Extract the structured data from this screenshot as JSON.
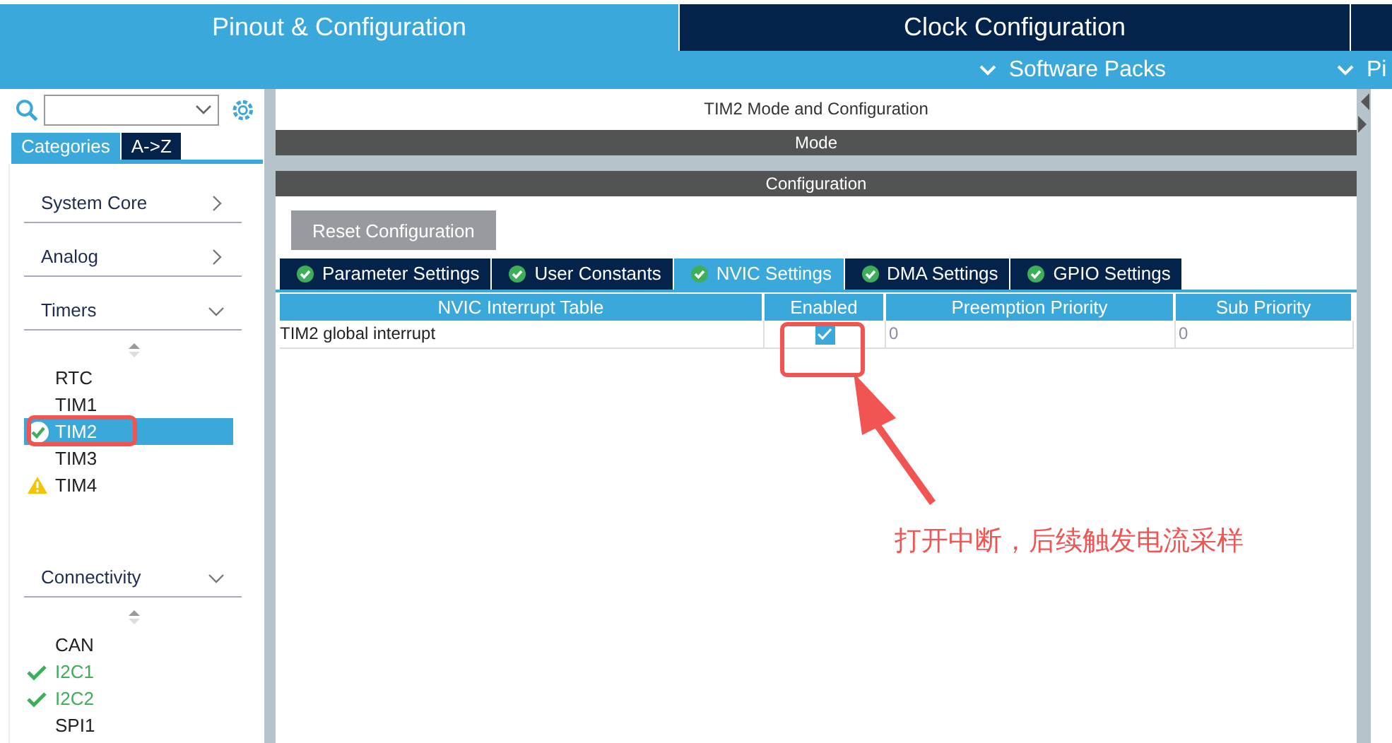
{
  "top_tabs": [
    {
      "label": "Pinout & Configuration",
      "selected": true
    },
    {
      "label": "Clock Configuration",
      "selected": false
    }
  ],
  "sub_menu": [
    {
      "label": "Software Packs"
    },
    {
      "label": "Pi"
    }
  ],
  "left_tabs": [
    {
      "label": "Categories",
      "selected": true
    },
    {
      "label": "A->Z",
      "selected": false
    }
  ],
  "categories": [
    {
      "label": "System Core",
      "expanded": false
    },
    {
      "label": "Analog",
      "expanded": false
    },
    {
      "label": "Timers",
      "expanded": true,
      "items": [
        {
          "label": "RTC",
          "kind": "plain",
          "selected": false
        },
        {
          "label": "TIM1",
          "kind": "plain",
          "selected": false
        },
        {
          "label": "TIM2",
          "kind": "configured",
          "selected": true
        },
        {
          "label": "TIM3",
          "kind": "plain",
          "selected": false
        },
        {
          "label": "TIM4",
          "kind": "warning",
          "selected": false
        }
      ]
    },
    {
      "label": "Connectivity",
      "expanded": true,
      "items": [
        {
          "label": "CAN",
          "kind": "plain",
          "selected": false
        },
        {
          "label": "I2C1",
          "kind": "ok",
          "selected": false
        },
        {
          "label": "I2C2",
          "kind": "ok",
          "selected": false
        },
        {
          "label": "SPI1",
          "kind": "plain",
          "selected": false
        }
      ]
    }
  ],
  "panel_title": "TIM2 Mode and Configuration",
  "mode_header": "Mode",
  "config_header": "Configuration",
  "reset_button": "Reset Configuration",
  "config_tabs": [
    {
      "label": "Parameter Settings",
      "selected": false
    },
    {
      "label": "User Constants",
      "selected": false
    },
    {
      "label": "NVIC Settings",
      "selected": true
    },
    {
      "label": "DMA Settings",
      "selected": false
    },
    {
      "label": "GPIO Settings",
      "selected": false
    }
  ],
  "table": {
    "columns": [
      "NVIC Interrupt Table",
      "Enabled",
      "Preemption Priority",
      "Sub Priority"
    ],
    "rows": [
      {
        "name": "TIM2 global interrupt",
        "enabled": true,
        "preemption": "0",
        "sub": "0"
      }
    ]
  },
  "annotation": {
    "text": "打开中断，后续触发电流采样"
  }
}
